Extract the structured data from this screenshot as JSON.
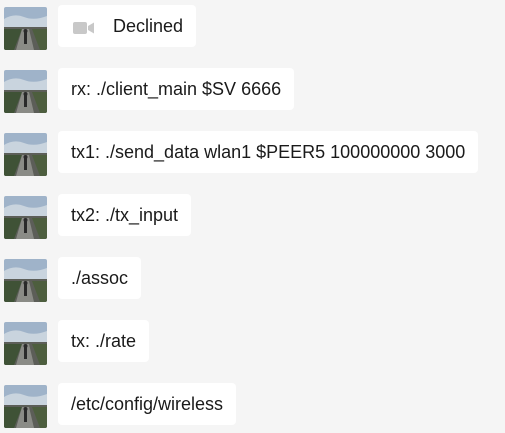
{
  "messages": [
    {
      "icon": "video-camera-icon",
      "text": "Declined"
    },
    {
      "text": "rx: ./client_main $SV 6666"
    },
    {
      "text": "tx1: ./send_data wlan1 $PEER5 100000000 3000"
    },
    {
      "text": "tx2: ./tx_input"
    },
    {
      "text": "./assoc"
    },
    {
      "text": "tx: ./rate"
    },
    {
      "text": "/etc/config/wireless"
    }
  ],
  "colors": {
    "background": "#f5f5f5",
    "bubble": "#ffffff",
    "text": "#1a1a1a",
    "icon": "#c8c8c8"
  }
}
